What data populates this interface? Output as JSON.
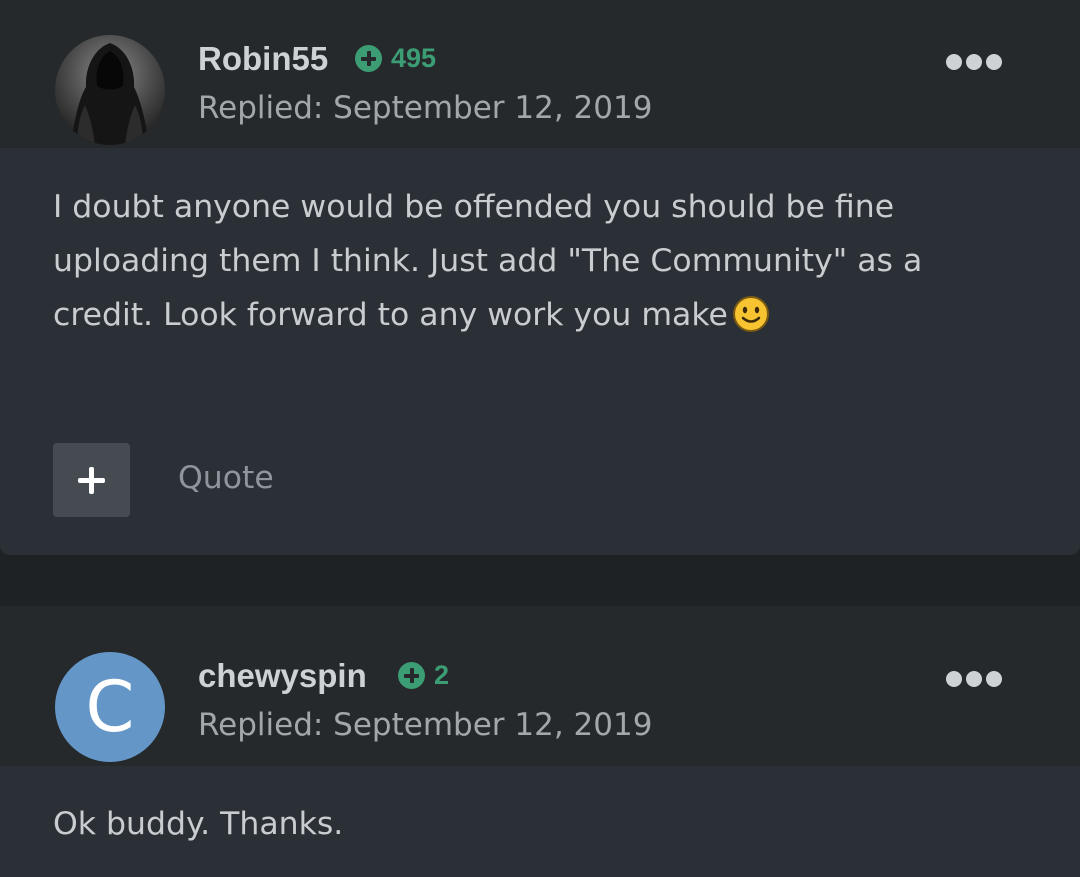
{
  "posts": [
    {
      "username": "Robin55",
      "reputation": "495",
      "reply_date": "Replied: September 12, 2019",
      "avatar": "hooded-figure-avatar",
      "body_lines": [
        "I doubt anyone would be offended you should be fine",
        "uploading them I think. Just add \"The Community\" as a",
        "credit. Look forward to any work you make"
      ],
      "emoji": "smiley-face-emoji",
      "quote_label": "Quote"
    },
    {
      "username": "chewyspin",
      "reputation": "2",
      "reply_date": "Replied: September 12, 2019",
      "avatar_letter": "C",
      "body_lines": [
        "Ok buddy. Thanks."
      ]
    }
  ],
  "colors": {
    "page_background": "#1f2225",
    "header_background": "#25292b",
    "body_background": "#2b3036",
    "reputation_green": "#3c9d74",
    "avatar_blue": "#6497c7"
  },
  "icons": [
    "reputation-plus-icon",
    "more-options-icon",
    "add-multiquote-icon"
  ]
}
